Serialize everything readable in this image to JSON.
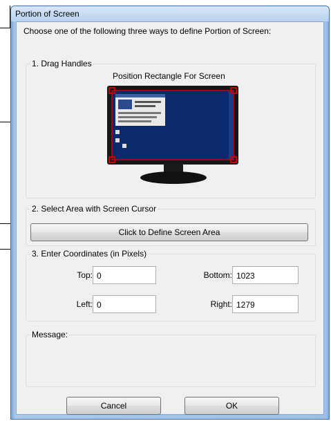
{
  "window": {
    "title": "Portion of Screen",
    "intro": "Choose one of the following three ways to define Portion of Screen:"
  },
  "drag_handles": {
    "label": "1. Drag Handles",
    "caption": "Position Rectangle For Screen"
  },
  "select_area": {
    "label": "2. Select Area with Screen Cursor",
    "button_label": "Click to Define Screen Area"
  },
  "coordinates": {
    "label": "3. Enter Coordinates (in Pixels)",
    "top_label": "Top:",
    "top_value": "0",
    "bottom_label": "Bottom:",
    "bottom_value": "1023",
    "left_label": "Left:",
    "left_value": "0",
    "right_label": "Right:",
    "right_value": "1279"
  },
  "message": {
    "label": "Message:"
  },
  "buttons": {
    "cancel": "Cancel",
    "ok": "OK"
  },
  "colors": {
    "monitor_screen": "#0b2a6e",
    "handle_red": "#cc0000"
  }
}
